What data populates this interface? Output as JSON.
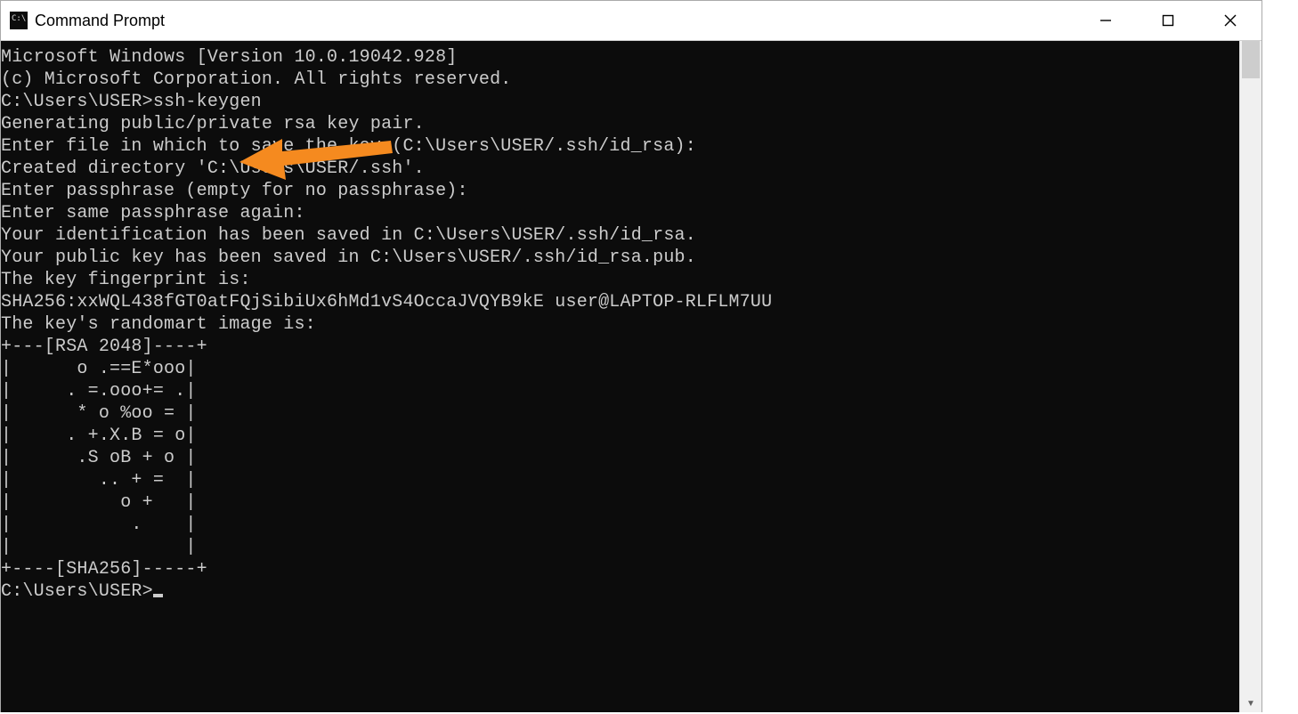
{
  "window": {
    "title": "Command Prompt"
  },
  "terminal": {
    "lines": [
      "Microsoft Windows [Version 10.0.19042.928]",
      "(c) Microsoft Corporation. All rights reserved.",
      "",
      "C:\\Users\\USER>ssh-keygen",
      "Generating public/private rsa key pair.",
      "Enter file in which to save the key (C:\\Users\\USER/.ssh/id_rsa):",
      "Created directory 'C:\\Users\\USER/.ssh'.",
      "Enter passphrase (empty for no passphrase):",
      "Enter same passphrase again:",
      "Your identification has been saved in C:\\Users\\USER/.ssh/id_rsa.",
      "Your public key has been saved in C:\\Users\\USER/.ssh/id_rsa.pub.",
      "The key fingerprint is:",
      "SHA256:xxWQL438fGT0atFQjSibiUx6hMd1vS4OccaJVQYB9kE user@LAPTOP-RLFLM7UU",
      "The key's randomart image is:",
      "+---[RSA 2048]----+",
      "|      o .==E*ooo|",
      "|     . =.ooo+= .|",
      "|      * o %oo = |",
      "|     . +.X.B = o|",
      "|      .S oB + o |",
      "|        .. + =  |",
      "|          o +   |",
      "|           .    |",
      "|                |",
      "+----[SHA256]-----+",
      "",
      "C:\\Users\\USER>"
    ],
    "cursor_after_last": true,
    "prompt_path": "C:\\Users\\USER",
    "command_entered": "ssh-keygen"
  },
  "annotation": {
    "arrow_color": "#f58a1f"
  },
  "colors": {
    "terminal_bg": "#0c0c0c",
    "terminal_fg": "#cccccc",
    "window_bg": "#ffffff"
  }
}
